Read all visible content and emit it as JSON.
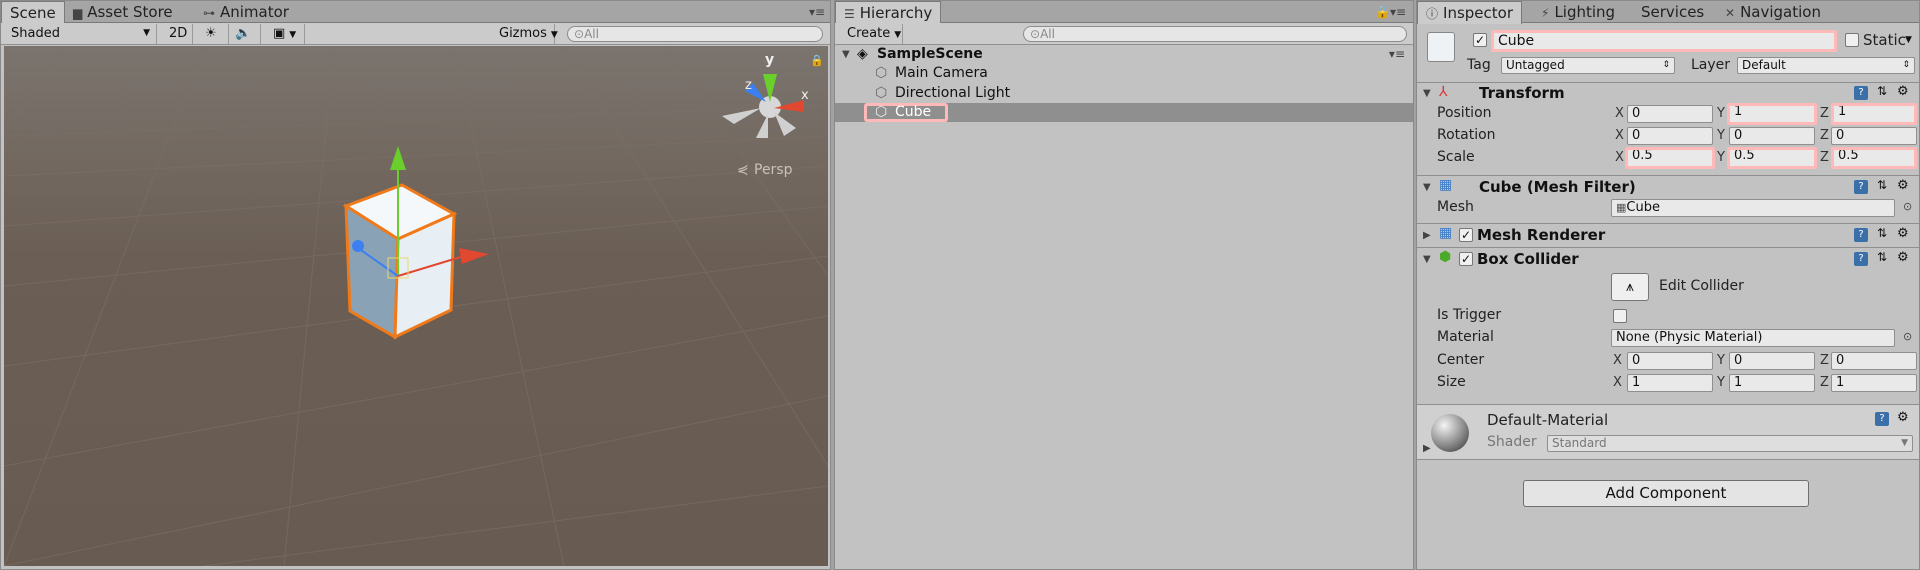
{
  "scene": {
    "tabs": [
      "Scene",
      "Asset Store",
      "Animator"
    ],
    "toolbar": {
      "shading": "Shaded",
      "mode_2d": "2D",
      "gizmos": "Gizmos"
    },
    "search_placeholder": "All",
    "persp_label": "Persp",
    "gizmo_axes": {
      "y": "y",
      "x": "x",
      "z": "z"
    }
  },
  "hierarchy": {
    "tab": "Hierarchy",
    "create": "Create",
    "search_placeholder": "All",
    "scene_name": "SampleScene",
    "items": [
      "Main Camera",
      "Directional Light",
      "Cube"
    ]
  },
  "inspector": {
    "tabs": [
      "Inspector",
      "Lighting",
      "Services",
      "Navigation"
    ],
    "object_name": "Cube",
    "static_label": "Static",
    "tag_label": "Tag",
    "tag_value": "Untagged",
    "layer_label": "Layer",
    "layer_value": "Default",
    "transform": {
      "title": "Transform",
      "position_label": "Position",
      "rotation_label": "Rotation",
      "scale_label": "Scale",
      "position": {
        "x": "0",
        "y": "1",
        "z": "1"
      },
      "rotation": {
        "x": "0",
        "y": "0",
        "z": "0"
      },
      "scale": {
        "x": "0.5",
        "y": "0.5",
        "z": "0.5"
      },
      "axes": {
        "x": "X",
        "y": "Y",
        "z": "Z"
      }
    },
    "mesh_filter": {
      "title": "Cube (Mesh Filter)",
      "mesh_label": "Mesh",
      "mesh_value": "Cube"
    },
    "mesh_renderer": {
      "title": "Mesh Renderer"
    },
    "box_collider": {
      "title": "Box Collider",
      "edit_collider": "Edit Collider",
      "is_trigger_label": "Is Trigger",
      "material_label": "Material",
      "material_value": "None (Physic Material)",
      "center_label": "Center",
      "size_label": "Size",
      "center": {
        "x": "0",
        "y": "0",
        "z": "0"
      },
      "size": {
        "x": "1",
        "y": "1",
        "z": "1"
      }
    },
    "material": {
      "name": "Default-Material",
      "shader_label": "Shader",
      "shader_value": "Standard"
    },
    "add_component": "Add Component"
  },
  "colors": {
    "highlight": "#ffb9b9",
    "selection": "#8f8f8f",
    "scene_bg": "#6b5f55",
    "cube_outline": "#f07a1a"
  }
}
